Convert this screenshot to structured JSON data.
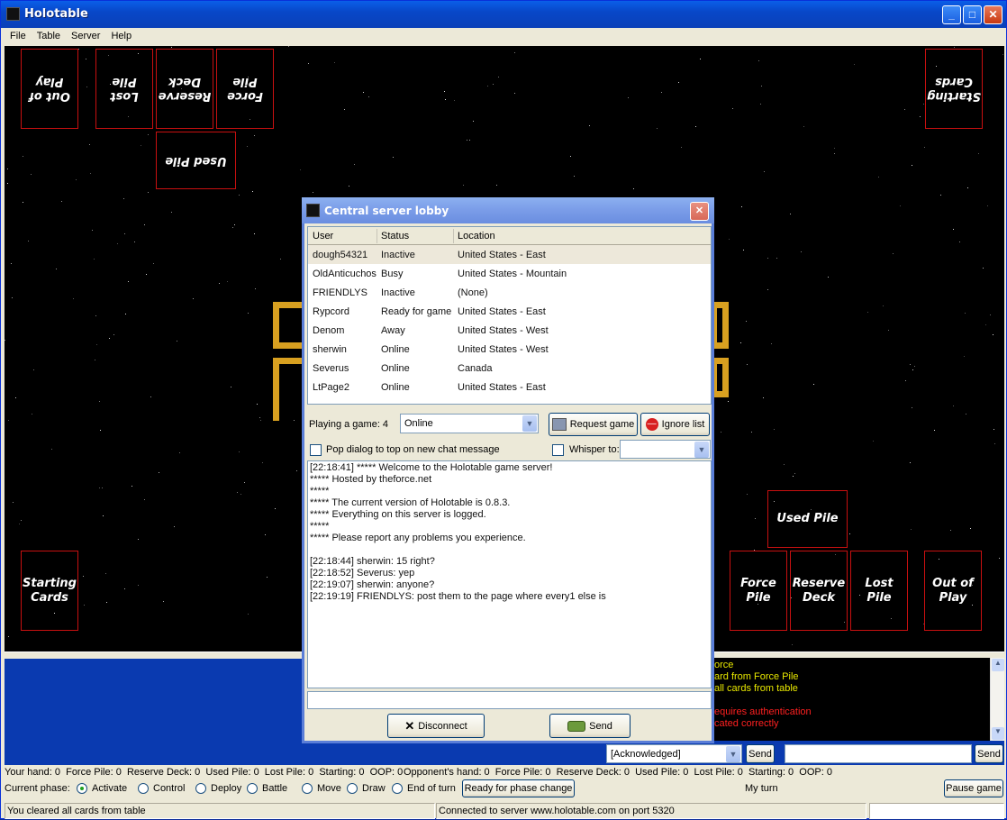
{
  "window": {
    "title": "Holotable"
  },
  "menu": [
    "File",
    "Table",
    "Server",
    "Help"
  ],
  "opponent_piles": {
    "out_of_play": "Out of Play",
    "lost_pile": "Lost Pile",
    "reserve_deck": "Reserve Deck",
    "force_pile": "Force Pile",
    "used_pile": "Used Pile",
    "starting_cards": "Starting Cards"
  },
  "my_piles": {
    "starting_cards": "Starting Cards",
    "used_pile": "Used Pile",
    "force_pile": "Force Pile",
    "reserve_deck": "Reserve Deck",
    "lost_pile": "Lost Pile",
    "out_of_play": "Out of Play"
  },
  "lobby": {
    "title": "Central server lobby",
    "columns": [
      "User",
      "Status",
      "Location"
    ],
    "users": [
      {
        "user": "dough54321",
        "status": "Inactive",
        "location": "United States - East"
      },
      {
        "user": "OldAnticuchos",
        "status": "Busy",
        "location": "United States - Mountain"
      },
      {
        "user": "FRIENDLYS",
        "status": "Inactive",
        "location": "(None)"
      },
      {
        "user": "Rypcord",
        "status": "Ready for game",
        "location": "United States - East"
      },
      {
        "user": "Denom",
        "status": "Away",
        "location": "United States - West"
      },
      {
        "user": "sherwin",
        "status": "Online",
        "location": "United States - West"
      },
      {
        "user": "Severus",
        "status": "Online",
        "location": "Canada"
      },
      {
        "user": "LtPage2",
        "status": "Online",
        "location": "United States - East"
      }
    ],
    "playing_label": "Playing a game: 4",
    "status_value": "Online",
    "request_game": "Request game",
    "ignore_list": "Ignore list",
    "pop_dialog_label": "Pop dialog to top on new chat message",
    "whisper_label": "Whisper to:",
    "chat": [
      "[22:18:41] ***** Welcome to the Holotable game server!",
      "***** Hosted by theforce.net",
      "*****",
      "***** The current version of Holotable is 0.8.3.",
      "***** Everything on this server is logged.",
      "*****",
      "***** Please report any problems you experience.",
      "",
      "[22:18:44] sherwin: 15 right?",
      "[22:18:52] Severus: yep",
      "[22:19:07] sherwin: anyone?",
      "[22:19:19] FRIENDLYS: post them to the page where every1 else is"
    ],
    "disconnect": "Disconnect",
    "send": "Send"
  },
  "messages": [
    {
      "text": "orce",
      "color": "#e8e800"
    },
    {
      "text": "ard from Force Pile",
      "color": "#e8e800"
    },
    {
      "text": "all cards from table",
      "color": "#e8e800"
    },
    {
      "text": "",
      "color": "#e8e800"
    },
    {
      "text": "equires authentication",
      "color": "#ff2020"
    },
    {
      "text": "cated correctly",
      "color": "#ff2020"
    }
  ],
  "controls": {
    "ack_value": "[Acknowledged]",
    "send1": "Send",
    "send2": "Send",
    "your_counts": "Your hand: 0  Force Pile: 0  Reserve Deck: 0  Used Pile: 0  Lost Pile: 0  Starting: 0  OOP: 0",
    "opp_counts": "Opponent's hand: 0  Force Pile: 0  Reserve Deck: 0  Used Pile: 0  Lost Pile: 0  Starting: 0  OOP: 0",
    "current_phase": "Current phase:",
    "phases": [
      "Activate",
      "Control",
      "Deploy",
      "Battle",
      "Move",
      "Draw",
      "End of turn"
    ],
    "ready_phase": "Ready for phase change",
    "my_turn": "My turn",
    "pause_game": "Pause game"
  },
  "status": {
    "left": "You cleared all cards from table",
    "center": "Connected to server www.holotable.com on port 5320"
  }
}
